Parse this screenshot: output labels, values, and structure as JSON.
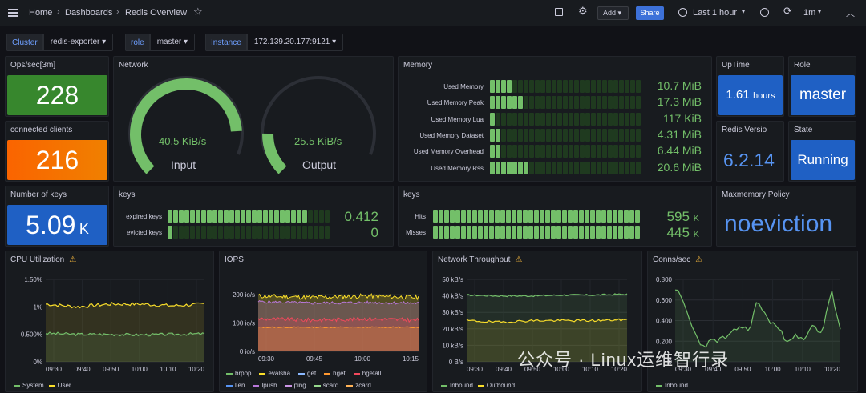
{
  "topbar": {
    "home": "Home",
    "dashboards": "Dashboards",
    "title": "Redis Overview",
    "add": "Add",
    "share": "Share",
    "time_range": "Last 1 hour",
    "refresh": "1m"
  },
  "filters": [
    {
      "label": "Cluster",
      "value": "redis-exporter"
    },
    {
      "label": "role",
      "value": "master"
    },
    {
      "label": "Instance",
      "value": "172.139.20.177:9121"
    }
  ],
  "panels": {
    "ops": {
      "title": "Ops/sec[3m]",
      "value": "228",
      "color": "#37872d"
    },
    "clients": {
      "title": "connected clients",
      "value": "216",
      "color": "#fa6400"
    },
    "network": {
      "title": "Network",
      "input_value": "40.5 KiB/s",
      "input_label": "Input",
      "output_value": "25.5 KiB/s",
      "output_label": "Output",
      "input_level": 0.82,
      "output_level": 0.17
    },
    "memory": {
      "title": "Memory",
      "rows": [
        {
          "label": "Used Memory",
          "value": "10.7 MiB",
          "level": 4
        },
        {
          "label": "Used Memory Peak",
          "value": "17.3 MiB",
          "level": 6
        },
        {
          "label": "Used Memory Lua",
          "value": "117 KiB",
          "level": 1
        },
        {
          "label": "Used Memory Dataset",
          "value": "4.31 MiB",
          "level": 2
        },
        {
          "label": "Used Memory Overhead",
          "value": "6.44 MiB",
          "level": 2
        },
        {
          "label": "Used Memory Rss",
          "value": "20.6 MiB",
          "level": 7
        }
      ]
    },
    "uptime": {
      "title": "UpTime",
      "value": "1.61",
      "unit": "hours"
    },
    "role": {
      "title": "Role",
      "value": "master"
    },
    "version": {
      "title": "Redis Versio",
      "value": "6.2.14"
    },
    "state": {
      "title": "State",
      "value": "Running"
    },
    "keys_count": {
      "title": "Number of keys",
      "value": "5.09",
      "unit": "K"
    },
    "keys_exp": {
      "title": "keys",
      "rows": [
        {
          "label": "expired keys",
          "value": "0.412",
          "level": 25
        },
        {
          "label": "evicted keys",
          "value": "0",
          "level": 1
        }
      ]
    },
    "keys_hits": {
      "title": "keys",
      "rows": [
        {
          "label": "Hits",
          "value": "595",
          "unit": "K",
          "level": 38
        },
        {
          "label": "Misses",
          "value": "445",
          "unit": "K",
          "level": 38
        }
      ]
    },
    "maxmem": {
      "title": "Maxmemory Policy",
      "value": "noeviction"
    },
    "cpu": {
      "title": "CPU Utilization",
      "yticks": [
        "1.50%",
        "1%",
        "0.500%",
        "0%"
      ],
      "xticks": [
        "09:30",
        "09:40",
        "09:50",
        "10:00",
        "10:10",
        "10:20"
      ],
      "legend": [
        "System",
        "User"
      ]
    },
    "iops": {
      "title": "IOPS",
      "yticks": [
        "200 io/s",
        "100 io/s",
        "0 io/s"
      ],
      "xticks": [
        "09:30",
        "09:45",
        "10:00",
        "10:15"
      ],
      "legend": [
        "brpop",
        "evalsha",
        "get",
        "hget",
        "hgetall",
        "llen",
        "lpush",
        "ping",
        "scard",
        "zcard"
      ]
    },
    "net": {
      "title": "Network Throughput",
      "yticks": [
        "50 kB/s",
        "40 kB/s",
        "30 kB/s",
        "20 kB/s",
        "10 kB/s",
        "0 B/s"
      ],
      "xticks": [
        "09:30",
        "09:40",
        "09:50",
        "10:00",
        "10:10",
        "10:20"
      ],
      "legend": [
        "Inbound",
        "Outbound"
      ]
    },
    "conns": {
      "title": "Conns/sec",
      "yticks": [
        "0.800",
        "0.600",
        "0.400",
        "0.200",
        "0"
      ],
      "xticks": [
        "09:30",
        "09:40",
        "09:50",
        "10:00",
        "10:10",
        "10:20"
      ],
      "legend": [
        "Inbound"
      ]
    }
  },
  "colors": {
    "green": "#73bf69",
    "yellow": "#fade2a",
    "blue": "#3274d9",
    "red": "#f2495c",
    "orange": "#ff9830",
    "purple": "#b877d9"
  },
  "chart_data": [
    {
      "type": "line",
      "title": "CPU Utilization",
      "x": [
        "09:30",
        "09:40",
        "09:50",
        "10:00",
        "10:10",
        "10:20"
      ],
      "ylim": [
        0,
        1.5
      ],
      "series": [
        {
          "name": "System",
          "values": [
            0.52,
            0.5,
            0.5,
            0.49,
            0.5,
            0.51
          ]
        },
        {
          "name": "User",
          "values": [
            1.05,
            1.0,
            1.05,
            1.05,
            1.02,
            1.05
          ]
        }
      ]
    },
    {
      "type": "area",
      "title": "IOPS",
      "x": [
        "09:30",
        "09:45",
        "10:00",
        "10:15"
      ],
      "ylim": [
        0,
        200
      ],
      "series": [
        {
          "name": "evalsha",
          "values": [
            195,
            190,
            195,
            190
          ]
        },
        {
          "name": "lpush",
          "values": [
            175,
            170,
            172,
            170
          ]
        },
        {
          "name": "hgetall",
          "values": [
            115,
            110,
            115,
            110
          ]
        },
        {
          "name": "hget",
          "values": [
            85,
            85,
            85,
            85
          ]
        }
      ]
    },
    {
      "type": "line",
      "title": "Network Throughput",
      "x": [
        "09:30",
        "09:40",
        "09:50",
        "10:00",
        "10:10",
        "10:20"
      ],
      "ylim": [
        0,
        50
      ],
      "series": [
        {
          "name": "Inbound",
          "values": [
            40.5,
            40,
            40,
            40.5,
            40.5,
            41
          ]
        },
        {
          "name": "Outbound",
          "values": [
            25,
            24,
            25,
            25,
            25,
            25.5
          ]
        }
      ]
    },
    {
      "type": "line",
      "title": "Conns/sec",
      "x": [
        "09:30",
        "09:40",
        "09:50",
        "10:00",
        "10:10",
        "10:20"
      ],
      "ylim": [
        0,
        0.8
      ],
      "series": [
        {
          "name": "Inbound",
          "values": [
            0.72,
            0.5,
            0.18,
            0.25,
            0.35,
            0.3
          ]
        }
      ]
    }
  ],
  "watermark": "公众号 · Linux运维智行录"
}
